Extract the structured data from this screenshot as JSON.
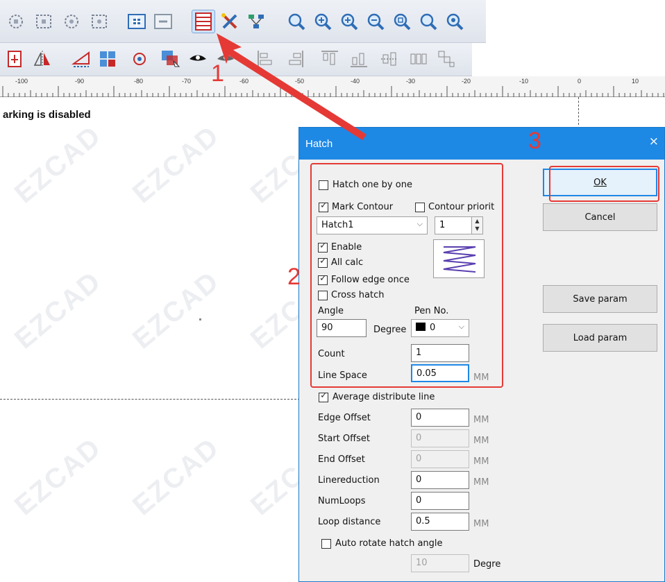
{
  "canvas": {
    "status_message": "arking is disabled",
    "watermark_text": "EZCAD"
  },
  "ruler": {
    "labels": [
      "-100",
      "-90",
      "-80",
      "-70",
      "-60",
      "-50",
      "-40",
      "-30",
      "-20",
      "-10",
      "0",
      "10"
    ]
  },
  "toolbar": {
    "icons": [
      "node-edit-icon",
      "node-edit-icon",
      "node-edit-icon",
      "node-edit-icon",
      "group-icon",
      "ungroup-icon",
      "hatch-icon",
      "tools-icon",
      "layout-icon",
      "zoom-icon",
      "zoom-in-icon",
      "zoom-in-icon",
      "zoom-out-icon",
      "zoom-all-icon",
      "zoom-icon",
      "zoom-selection-icon"
    ],
    "row2_icons": [
      "import-icon",
      "mirror-icon",
      "offset-icon",
      "array-icon",
      "rotate-icon",
      "overlap-icon",
      "eye-icon",
      "eye-icon",
      "align-left-icon",
      "align-right-icon",
      "align-top-icon",
      "align-bottom-icon",
      "align-center-icon",
      "distribute-icon"
    ]
  },
  "dialog": {
    "title": "Hatch",
    "close": "×",
    "hatch_one_by_one": "Hatch one by one",
    "mark_contour": "Mark Contour",
    "contour_priority": "Contour priorit",
    "hatch_select": "Hatch1",
    "hatch_num": "1",
    "enable": "Enable",
    "all_calc": "All calc",
    "follow_edge_once": "Follow edge once",
    "cross_hatch": "Cross hatch",
    "angle_label": "Angle",
    "angle_value": "90",
    "angle_unit": "Degree",
    "pen_label": "Pen No.",
    "pen_value": "0",
    "count_label": "Count",
    "count_value": "1",
    "line_space_label": "Line Space",
    "line_space_value": "0.05",
    "line_space_unit": "MM",
    "average_distribute": "Average distribute line",
    "edge_offset_label": "Edge Offset",
    "edge_offset_value": "0",
    "start_offset_label": "Start Offset",
    "start_offset_value": "0",
    "end_offset_label": "End Offset",
    "end_offset_value": "0",
    "linereduction_label": "Linereduction",
    "linereduction_value": "0",
    "numloops_label": "NumLoops",
    "numloops_value": "0",
    "loop_distance_label": "Loop distance",
    "loop_distance_value": "0.5",
    "mm": "MM",
    "auto_rotate": "Auto rotate hatch angle",
    "auto_rotate_value": "10",
    "auto_rotate_unit": "Degre",
    "ok": "OK",
    "cancel": "Cancel",
    "save_param": "Save param",
    "load_param": "Load param"
  },
  "annotations": {
    "step1": "1",
    "step2": "2",
    "step3": "3",
    "color": "#e53935"
  }
}
